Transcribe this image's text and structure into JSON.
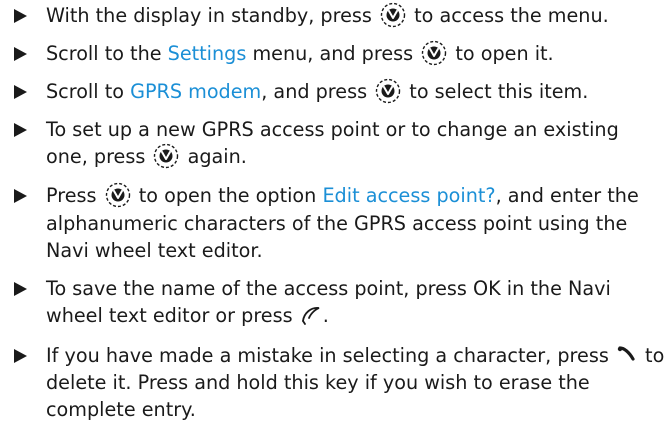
{
  "colors": {
    "text": "#1a1a1a",
    "highlight": "#1b8fd6"
  },
  "icons": {
    "navi": "navi-wheel-icon",
    "end": "end-call-icon",
    "send": "clear-key-icon"
  },
  "steps": [
    {
      "a": "With the display in standby, press",
      "b": "to access the menu."
    },
    {
      "a": "Scroll to the",
      "hl": "Settings",
      "b": "menu, and press",
      "c": "to open it."
    },
    {
      "a": "Scroll to",
      "hl": "GPRS modem",
      "b": ", and press",
      "c": "to select this item."
    },
    {
      "a": "To set up a new GPRS access point or to change an existing one, press",
      "b": "again."
    },
    {
      "a": "Press",
      "b": "to open the option",
      "hl": "Edit access point?",
      "c": ", and enter the alphanumeric characters of the GPRS access point using the Navi wheel text editor."
    },
    {
      "a": "To save the name of the access point, press OK in the Navi wheel text editor or press",
      "b": "."
    },
    {
      "a": "If you have made a mistake in selecting a character, press",
      "b": "to delete it. Press and hold this key if you wish to erase the complete entry."
    }
  ]
}
